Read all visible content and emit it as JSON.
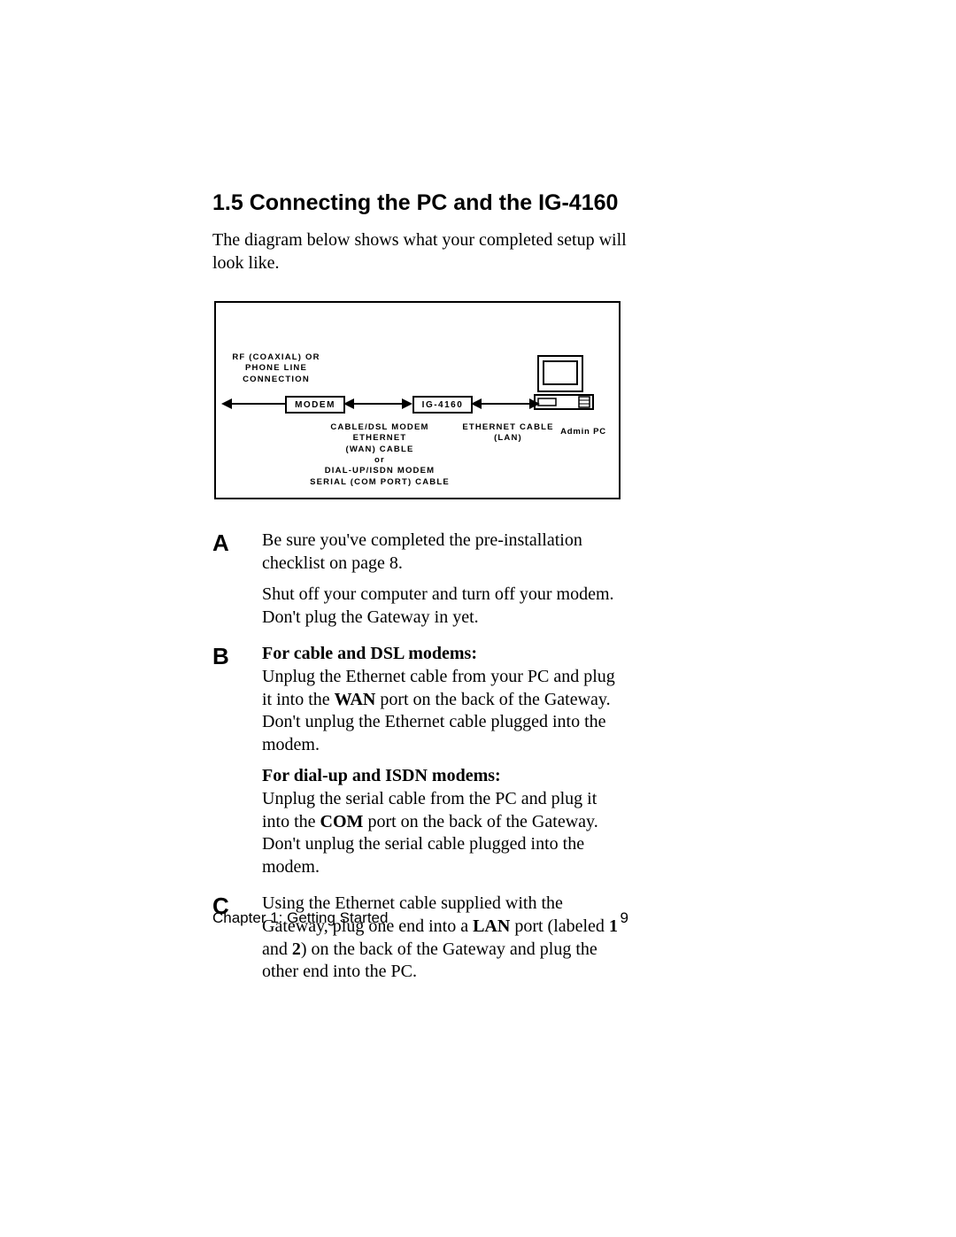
{
  "section": {
    "title": "1.5 Connecting the PC and the IG-4160",
    "intro": "The diagram below shows what your completed setup will look like."
  },
  "diagram": {
    "top_label_l1": "RF (COAXIAL) OR",
    "top_label_l2": "PHONE LINE",
    "top_label_l3": "CONNECTION",
    "modem_box": "MODEM",
    "ig_box": "IG-4160",
    "mid_label_l1": "CABLE/DSL MODEM",
    "mid_label_l2": "ETHERNET",
    "mid_label_l3": "(WAN) CABLE",
    "mid_label_l4": "or",
    "mid_label_l5": "DIAL-UP/ISDN MODEM",
    "mid_label_l6": "SERIAL (COM PORT) CABLE",
    "right_label_l1": "ETHERNET CABLE",
    "right_label_l2": "(LAN)",
    "admin_label": "Admin PC"
  },
  "steps": {
    "A": {
      "letter": "A",
      "p1": "Be sure you've completed the pre-installation checklist on page 8.",
      "p2": "Shut off your computer and turn off your modem. Don't plug the Gateway in yet."
    },
    "B": {
      "letter": "B",
      "h1": "For cable and DSL modems:",
      "p1a": "Unplug the Ethernet cable from your PC and plug it into the ",
      "p1b": "WAN",
      "p1c": " port on the back of the Gateway. Don't unplug the Ethernet cable plugged into the modem.",
      "h2": "For dial-up and ISDN modems:",
      "p2a": "Unplug the serial cable from the PC and plug it into the ",
      "p2b": "COM",
      "p2c": " port on the back of the Gateway. Don't unplug the serial cable plugged into the modem."
    },
    "C": {
      "letter": "C",
      "p1a": "Using the Ethernet cable supplied with the Gateway, plug one end into a ",
      "p1b": "LAN",
      "p1c": " port (labeled ",
      "p1d": "1",
      "p1e": " and ",
      "p1f": "2",
      "p1g": ") on the back of the Gateway and plug the other end into the PC."
    }
  },
  "footer": {
    "chapter": "Chapter 1: Getting Started",
    "page": "9"
  }
}
